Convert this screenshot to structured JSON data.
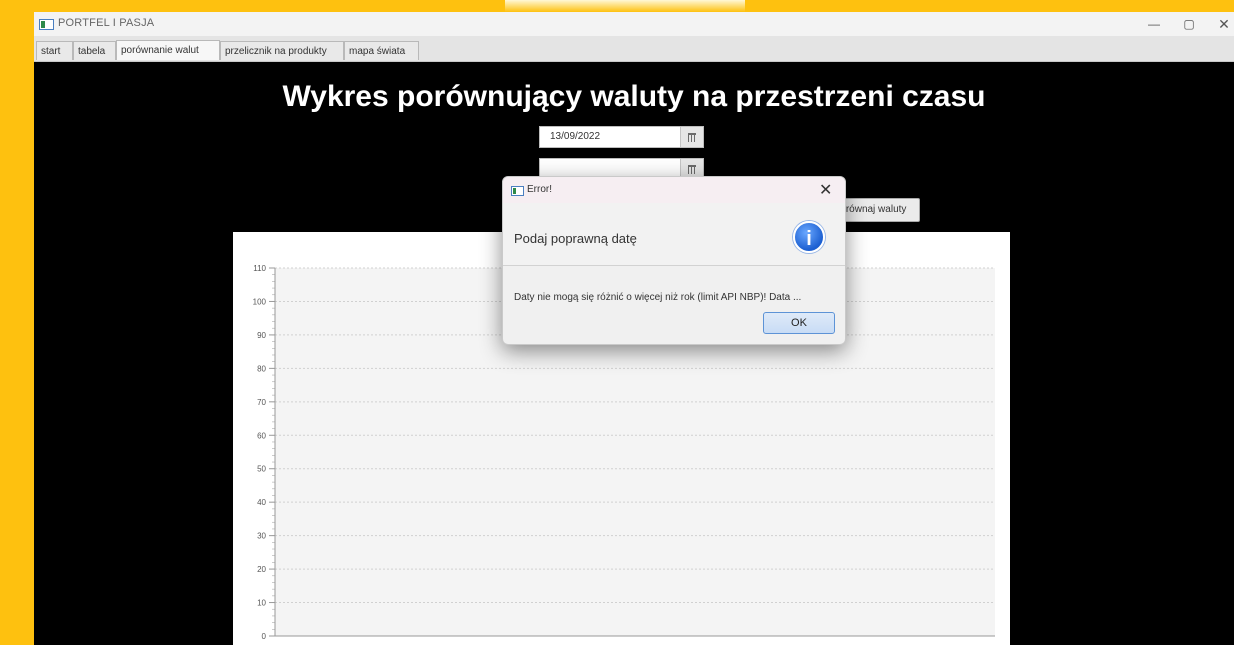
{
  "window": {
    "title": "PORTFEL I PASJA",
    "minimize_glyph": "—",
    "maximize_glyph": "▢",
    "close_glyph": "✕"
  },
  "tabs": [
    {
      "label": "start",
      "active": false
    },
    {
      "label": "tabela",
      "active": false
    },
    {
      "label": "porównanie walut",
      "active": true
    },
    {
      "label": "przelicznik na produkty",
      "active": false
    },
    {
      "label": "mapa świata",
      "active": false
    }
  ],
  "main": {
    "title": "Wykres porównujący waluty na przestrzeni czasu",
    "start_date": "13/09/2022",
    "end_date": "",
    "compare_button": "Porównaj waluty"
  },
  "chart_data": {
    "type": "line",
    "yticks": [
      "0",
      "10",
      "20",
      "30",
      "40",
      "50",
      "60",
      "70",
      "80",
      "90",
      "100",
      "110"
    ],
    "ylim": [
      0,
      110
    ],
    "grid": true,
    "series": []
  },
  "dialog": {
    "title": "Error!",
    "close_glyph": "✕",
    "header": "Podaj poprawną datę",
    "icon_glyph": "i",
    "content": "Daty nie mogą się różnić o więcej niż rok (limit API NBP)! Data ...",
    "ok_label": "OK"
  },
  "colors": {
    "background": "#fec10f",
    "content_bg": "#000000",
    "accent": "#1c5fd1"
  }
}
